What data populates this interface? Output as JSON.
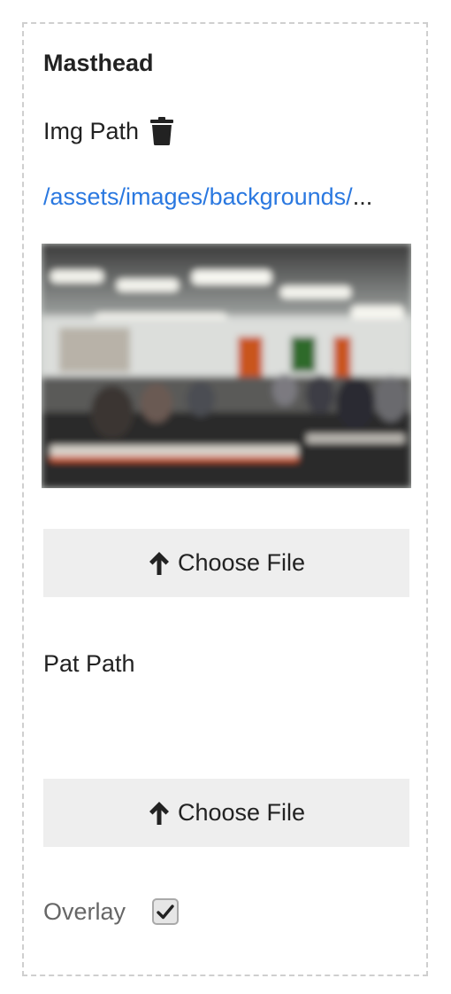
{
  "panel": {
    "title": "Masthead",
    "img_path": {
      "label": "Img Path",
      "delete_icon": "trash-icon",
      "value_visible": "/assets/images/backgrounds/",
      "value_ellipsis": "...",
      "link_color": "#2a78e0"
    },
    "img_path_upload": {
      "label": "Choose File",
      "icon": "arrow-up-icon"
    },
    "pat_path": {
      "label": "Pat Path",
      "value": ""
    },
    "pat_path_upload": {
      "label": "Choose File",
      "icon": "arrow-up-icon"
    },
    "overlay": {
      "label": "Overlay",
      "checked": true
    }
  },
  "colors": {
    "button_bg": "#eeeeee",
    "border_dashed": "#cfcfcf"
  }
}
